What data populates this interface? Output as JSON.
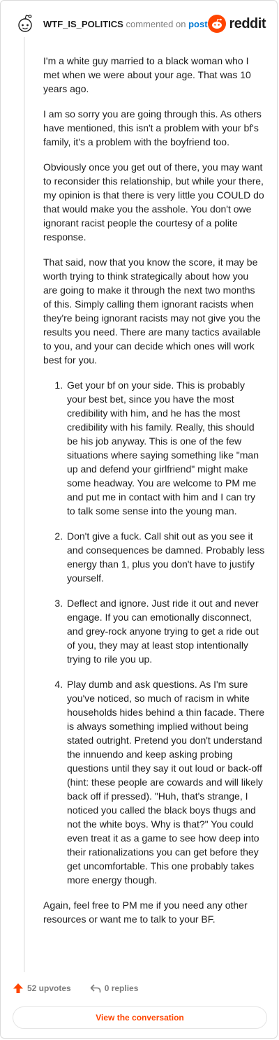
{
  "header": {
    "author": "WTF_IS_POLITICS",
    "action": "commented on",
    "post_link": "post",
    "logo_text": "reddit"
  },
  "comment": {
    "paragraphs_before": [
      "I'm a white guy married to a black woman who I met when we were about your age. That was 10 years ago.",
      "I am so sorry you are going through this. As others have mentioned, this isn't a problem with your bf's family, it's a problem with the boyfriend too.",
      "Obviously once you get out of there, you may want to reconsider this relationship, but while your there, my opinion is that there is very little you COULD do that would make you the asshole. You don't owe ignorant racist people the courtesy of a polite response.",
      "That said, now that you know the score, it may be worth trying to think strategically about how you are going to make it through the next two months of this. Simply calling them ignorant racists when they're being ignorant racists may not give you the results you need. There are many tactics available to you, and your can decide which ones will work best for you."
    ],
    "list_items": [
      "Get your bf on your side. This is probably your best bet, since you have the most credibility with him, and he has the most credibility with his family. Really, this should be his job anyway. This is one of the few situations where saying something like \"man up and defend your girlfriend\" might make some headway. You are welcome to PM me and put me in contact with him and I can try to talk some sense into the young man.",
      "Don't give a fuck. Call shit out as you see it and consequences be damned. Probably less energy than 1, plus you don't have to justify yourself.",
      "Deflect and ignore. Just ride it out and never engage. If you can emotionally disconnect, and grey-rock anyone trying to get a ride out of you, they may at least stop intentionally trying to rile you up.",
      "Play dumb and ask questions. As I'm sure you've noticed, so much of racism in white households hides behind a thin facade. There is always something implied without being stated outright. Pretend you don't understand the innuendo and keep asking probing questions until they say it out loud or back-off (hint: these people are cowards and will likely back off if pressed). \"Huh, that's strange, I noticed you called the black boys thugs and not the white boys. Why is that?\" You could even treat it as a game to see how deep into their rationalizations you can get before they get uncomfortable. This one probably takes more energy though."
    ],
    "closing": "Again, feel free to PM me if you need any other resources or want me to talk to your BF."
  },
  "footer": {
    "upvotes": "52 upvotes",
    "replies": "0 replies",
    "view_button": "View the conversation"
  },
  "colors": {
    "brand": "#ff4500",
    "link": "#0079d3",
    "muted": "#7c7c7c"
  },
  "icons": [
    "snoo-avatar-icon",
    "reddit-logo-icon",
    "upvote-arrow-icon",
    "reply-arrow-icon"
  ]
}
